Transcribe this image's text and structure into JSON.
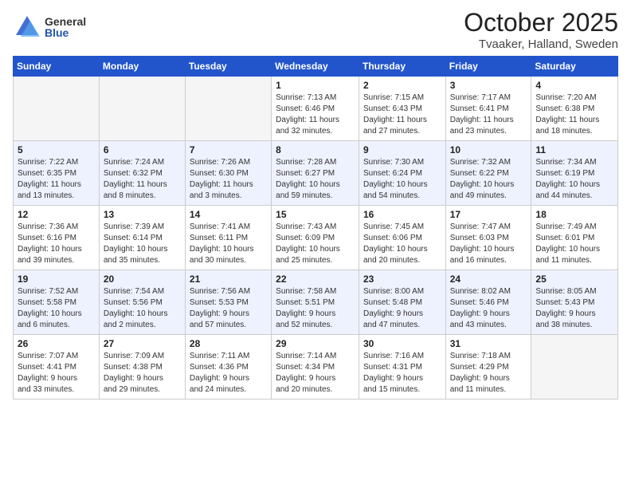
{
  "header": {
    "logo_general": "General",
    "logo_blue": "Blue",
    "month": "October 2025",
    "location": "Tvaaker, Halland, Sweden"
  },
  "weekdays": [
    "Sunday",
    "Monday",
    "Tuesday",
    "Wednesday",
    "Thursday",
    "Friday",
    "Saturday"
  ],
  "weeks": [
    [
      {
        "day": "",
        "info": ""
      },
      {
        "day": "",
        "info": ""
      },
      {
        "day": "",
        "info": ""
      },
      {
        "day": "1",
        "info": "Sunrise: 7:13 AM\nSunset: 6:46 PM\nDaylight: 11 hours\nand 32 minutes."
      },
      {
        "day": "2",
        "info": "Sunrise: 7:15 AM\nSunset: 6:43 PM\nDaylight: 11 hours\nand 27 minutes."
      },
      {
        "day": "3",
        "info": "Sunrise: 7:17 AM\nSunset: 6:41 PM\nDaylight: 11 hours\nand 23 minutes."
      },
      {
        "day": "4",
        "info": "Sunrise: 7:20 AM\nSunset: 6:38 PM\nDaylight: 11 hours\nand 18 minutes."
      }
    ],
    [
      {
        "day": "5",
        "info": "Sunrise: 7:22 AM\nSunset: 6:35 PM\nDaylight: 11 hours\nand 13 minutes."
      },
      {
        "day": "6",
        "info": "Sunrise: 7:24 AM\nSunset: 6:32 PM\nDaylight: 11 hours\nand 8 minutes."
      },
      {
        "day": "7",
        "info": "Sunrise: 7:26 AM\nSunset: 6:30 PM\nDaylight: 11 hours\nand 3 minutes."
      },
      {
        "day": "8",
        "info": "Sunrise: 7:28 AM\nSunset: 6:27 PM\nDaylight: 10 hours\nand 59 minutes."
      },
      {
        "day": "9",
        "info": "Sunrise: 7:30 AM\nSunset: 6:24 PM\nDaylight: 10 hours\nand 54 minutes."
      },
      {
        "day": "10",
        "info": "Sunrise: 7:32 AM\nSunset: 6:22 PM\nDaylight: 10 hours\nand 49 minutes."
      },
      {
        "day": "11",
        "info": "Sunrise: 7:34 AM\nSunset: 6:19 PM\nDaylight: 10 hours\nand 44 minutes."
      }
    ],
    [
      {
        "day": "12",
        "info": "Sunrise: 7:36 AM\nSunset: 6:16 PM\nDaylight: 10 hours\nand 39 minutes."
      },
      {
        "day": "13",
        "info": "Sunrise: 7:39 AM\nSunset: 6:14 PM\nDaylight: 10 hours\nand 35 minutes."
      },
      {
        "day": "14",
        "info": "Sunrise: 7:41 AM\nSunset: 6:11 PM\nDaylight: 10 hours\nand 30 minutes."
      },
      {
        "day": "15",
        "info": "Sunrise: 7:43 AM\nSunset: 6:09 PM\nDaylight: 10 hours\nand 25 minutes."
      },
      {
        "day": "16",
        "info": "Sunrise: 7:45 AM\nSunset: 6:06 PM\nDaylight: 10 hours\nand 20 minutes."
      },
      {
        "day": "17",
        "info": "Sunrise: 7:47 AM\nSunset: 6:03 PM\nDaylight: 10 hours\nand 16 minutes."
      },
      {
        "day": "18",
        "info": "Sunrise: 7:49 AM\nSunset: 6:01 PM\nDaylight: 10 hours\nand 11 minutes."
      }
    ],
    [
      {
        "day": "19",
        "info": "Sunrise: 7:52 AM\nSunset: 5:58 PM\nDaylight: 10 hours\nand 6 minutes."
      },
      {
        "day": "20",
        "info": "Sunrise: 7:54 AM\nSunset: 5:56 PM\nDaylight: 10 hours\nand 2 minutes."
      },
      {
        "day": "21",
        "info": "Sunrise: 7:56 AM\nSunset: 5:53 PM\nDaylight: 9 hours\nand 57 minutes."
      },
      {
        "day": "22",
        "info": "Sunrise: 7:58 AM\nSunset: 5:51 PM\nDaylight: 9 hours\nand 52 minutes."
      },
      {
        "day": "23",
        "info": "Sunrise: 8:00 AM\nSunset: 5:48 PM\nDaylight: 9 hours\nand 47 minutes."
      },
      {
        "day": "24",
        "info": "Sunrise: 8:02 AM\nSunset: 5:46 PM\nDaylight: 9 hours\nand 43 minutes."
      },
      {
        "day": "25",
        "info": "Sunrise: 8:05 AM\nSunset: 5:43 PM\nDaylight: 9 hours\nand 38 minutes."
      }
    ],
    [
      {
        "day": "26",
        "info": "Sunrise: 7:07 AM\nSunset: 4:41 PM\nDaylight: 9 hours\nand 33 minutes."
      },
      {
        "day": "27",
        "info": "Sunrise: 7:09 AM\nSunset: 4:38 PM\nDaylight: 9 hours\nand 29 minutes."
      },
      {
        "day": "28",
        "info": "Sunrise: 7:11 AM\nSunset: 4:36 PM\nDaylight: 9 hours\nand 24 minutes."
      },
      {
        "day": "29",
        "info": "Sunrise: 7:14 AM\nSunset: 4:34 PM\nDaylight: 9 hours\nand 20 minutes."
      },
      {
        "day": "30",
        "info": "Sunrise: 7:16 AM\nSunset: 4:31 PM\nDaylight: 9 hours\nand 15 minutes."
      },
      {
        "day": "31",
        "info": "Sunrise: 7:18 AM\nSunset: 4:29 PM\nDaylight: 9 hours\nand 11 minutes."
      },
      {
        "day": "",
        "info": ""
      }
    ]
  ]
}
